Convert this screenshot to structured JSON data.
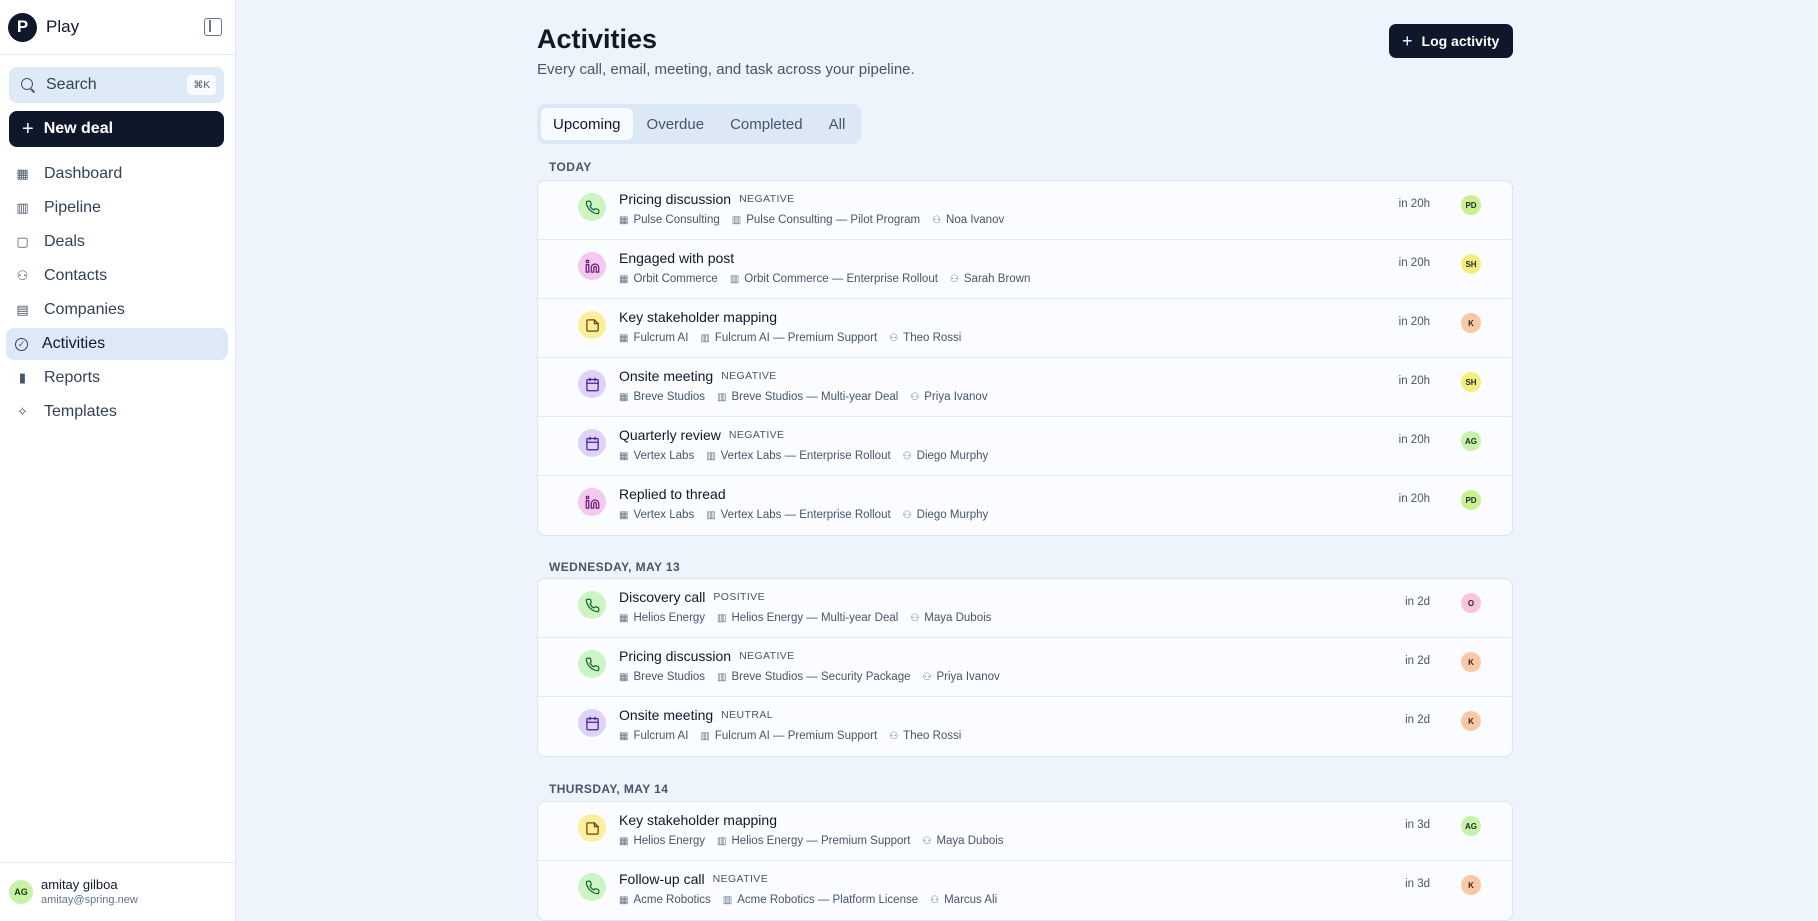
{
  "app": {
    "name": "Play",
    "logo_letter": "P"
  },
  "search": {
    "label": "Search",
    "shortcut": "⌘K"
  },
  "new_deal": {
    "label": "New deal"
  },
  "nav": [
    {
      "label": "Dashboard",
      "icon": "dashboard-icon"
    },
    {
      "label": "Pipeline",
      "icon": "pipeline-icon"
    },
    {
      "label": "Deals",
      "icon": "deals-icon"
    },
    {
      "label": "Contacts",
      "icon": "contacts-icon"
    },
    {
      "label": "Companies",
      "icon": "companies-icon"
    },
    {
      "label": "Activities",
      "icon": "activities-icon",
      "active": true
    },
    {
      "label": "Reports",
      "icon": "reports-icon"
    },
    {
      "label": "Templates",
      "icon": "templates-icon"
    }
  ],
  "user": {
    "initials": "AG",
    "name": "amitay gilboa",
    "email": "amitay@spring.new"
  },
  "page": {
    "title": "Activities",
    "subtitle": "Every call, email, meeting, and task across your pipeline.",
    "log_button": "Log activity"
  },
  "tabs": [
    "Upcoming",
    "Overdue",
    "Completed",
    "All"
  ],
  "active_tab": "Upcoming",
  "groups": [
    {
      "label": "TODAY",
      "rows": [
        {
          "type": "call",
          "title": "Pricing discussion",
          "badge": "NEGATIVE",
          "company": "Pulse Consulting",
          "deal": "Pulse Consulting — Pilot Program",
          "person": "Noa Ivanov",
          "due": "in 20h",
          "owner": "PD"
        },
        {
          "type": "linkedin",
          "title": "Engaged with post",
          "badge": "",
          "company": "Orbit Commerce",
          "deal": "Orbit Commerce — Enterprise Rollout",
          "person": "Sarah Brown",
          "due": "in 20h",
          "owner": "SH"
        },
        {
          "type": "note",
          "title": "Key stakeholder mapping",
          "badge": "",
          "company": "Fulcrum AI",
          "deal": "Fulcrum AI — Premium Support",
          "person": "Theo Rossi",
          "due": "in 20h",
          "owner": "K"
        },
        {
          "type": "meeting",
          "title": "Onsite meeting",
          "badge": "NEGATIVE",
          "company": "Breve Studios",
          "deal": "Breve Studios — Multi-year Deal",
          "person": "Priya Ivanov",
          "due": "in 20h",
          "owner": "SH"
        },
        {
          "type": "meeting",
          "title": "Quarterly review",
          "badge": "NEGATIVE",
          "company": "Vertex Labs",
          "deal": "Vertex Labs — Enterprise Rollout",
          "person": "Diego Murphy",
          "due": "in 20h",
          "owner": "AG"
        },
        {
          "type": "linkedin",
          "title": "Replied to thread",
          "badge": "",
          "company": "Vertex Labs",
          "deal": "Vertex Labs — Enterprise Rollout",
          "person": "Diego Murphy",
          "due": "in 20h",
          "owner": "PD"
        }
      ]
    },
    {
      "label": "WEDNESDAY, MAY 13",
      "rows": [
        {
          "type": "call",
          "title": "Discovery call",
          "badge": "POSITIVE",
          "company": "Helios Energy",
          "deal": "Helios Energy — Multi-year Deal",
          "person": "Maya Dubois",
          "due": "in 2d",
          "owner": "O"
        },
        {
          "type": "call",
          "title": "Pricing discussion",
          "badge": "NEGATIVE",
          "company": "Breve Studios",
          "deal": "Breve Studios — Security Package",
          "person": "Priya Ivanov",
          "due": "in 2d",
          "owner": "K"
        },
        {
          "type": "meeting",
          "title": "Onsite meeting",
          "badge": "NEUTRAL",
          "company": "Fulcrum AI",
          "deal": "Fulcrum AI — Premium Support",
          "person": "Theo Rossi",
          "due": "in 2d",
          "owner": "K"
        }
      ]
    },
    {
      "label": "THURSDAY, MAY 14",
      "rows": [
        {
          "type": "note",
          "title": "Key stakeholder mapping",
          "badge": "",
          "company": "Helios Energy",
          "deal": "Helios Energy — Premium Support",
          "person": "Maya Dubois",
          "due": "in 3d",
          "owner": "AG"
        },
        {
          "type": "call",
          "title": "Follow-up call",
          "badge": "NEGATIVE",
          "company": "Acme Robotics",
          "deal": "Acme Robotics — Platform License",
          "person": "Marcus Ali",
          "due": "in 3d",
          "owner": "K"
        }
      ]
    }
  ],
  "colors": {
    "call_bg": "#cdf5c4",
    "call_fg": "#166534",
    "linkedin_bg": "#f2c9ef",
    "linkedin_fg": "#701a75",
    "note_bg": "#fbef9b",
    "note_fg": "#713f12",
    "meeting_bg": "#ddd3f8",
    "meeting_fg": "#4c1d95",
    "owner_PD": "#c9ef8f",
    "owner_SH": "#f3ef7d",
    "owner_K": "#fbc8a6",
    "owner_AG": "#c6f3a8",
    "owner_O": "#fbc5d8"
  }
}
